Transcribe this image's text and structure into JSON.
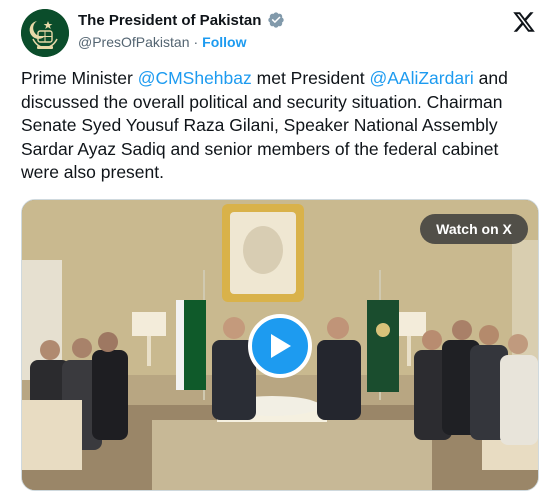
{
  "author": {
    "display_name": "The President of Pakistan",
    "handle": "@PresOfPakistan",
    "separator": "·",
    "follow_label": "Follow",
    "avatar_icon": "pakistan-emblem-icon",
    "verified_icon": "verified-badge-icon"
  },
  "platform": {
    "logo_icon": "x-logo-icon"
  },
  "tweet": {
    "part1": "Prime Minister ",
    "mention1": "@CMShehbaz",
    "part2": " met President ",
    "mention2": "@AAliZardari",
    "part3": " and discussed the overall political and security situation. Chairman Senate Syed Yousuf Raza Gilani, Speaker National Assembly Sardar Ayaz Sadiq and senior members of the federal cabinet were also present."
  },
  "media": {
    "watch_label": "Watch on X",
    "play_icon": "play-icon"
  },
  "colors": {
    "link": "#1d9bf0",
    "text": "#0f1419",
    "muted": "#536471",
    "verified": "#829aab"
  }
}
